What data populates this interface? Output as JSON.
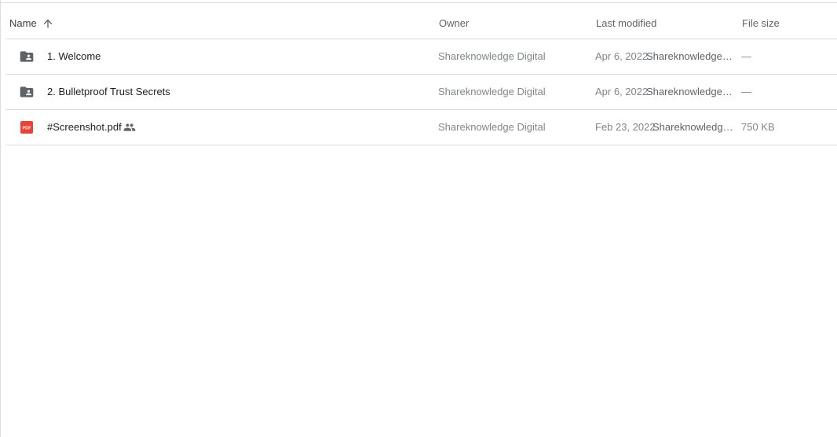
{
  "header": {
    "name_label": "Name",
    "owner_label": "Owner",
    "modified_label": "Last modified",
    "size_label": "File size",
    "sort_icon": "arrow-up-icon"
  },
  "files": [
    {
      "type": "shared-folder",
      "icon": "shared-folder-icon",
      "name": "1. Welcome",
      "shared": false,
      "owner": "Shareknowledge Digital",
      "modified_date": "Apr 6, 2022",
      "modified_by": "Shareknowledge Digital",
      "size": "—"
    },
    {
      "type": "shared-folder",
      "icon": "shared-folder-icon",
      "name": "2. Bulletproof Trust Secrets",
      "shared": false,
      "owner": "Shareknowledge Digital",
      "modified_date": "Apr 6, 2022",
      "modified_by": "Shareknowledge Digital",
      "size": "—"
    },
    {
      "type": "pdf",
      "icon": "pdf-icon",
      "icon_text": "PDF",
      "name": "#Screenshot.pdf",
      "shared": true,
      "shared_icon": "people-icon",
      "owner": "Shareknowledge Digital",
      "modified_date": "Feb 23, 2022",
      "modified_by": "Shareknowledge Digital",
      "size": "750 KB"
    }
  ],
  "colors": {
    "divider": "#dadce0",
    "folder_icon": "#5f6368",
    "pdf_red": "#ea4335",
    "primary_text": "#202124",
    "secondary_text": "#80868b"
  }
}
